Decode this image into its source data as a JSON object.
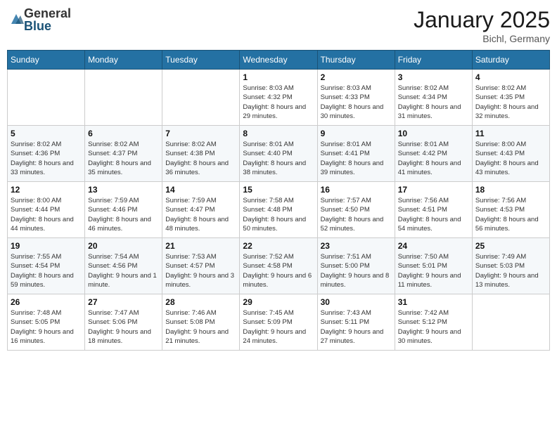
{
  "logo": {
    "general": "General",
    "blue": "Blue"
  },
  "header": {
    "month": "January 2025",
    "location": "Bichl, Germany"
  },
  "days_of_week": [
    "Sunday",
    "Monday",
    "Tuesday",
    "Wednesday",
    "Thursday",
    "Friday",
    "Saturday"
  ],
  "weeks": [
    [
      {
        "day": "",
        "info": ""
      },
      {
        "day": "",
        "info": ""
      },
      {
        "day": "",
        "info": ""
      },
      {
        "day": "1",
        "info": "Sunrise: 8:03 AM\nSunset: 4:32 PM\nDaylight: 8 hours and 29 minutes."
      },
      {
        "day": "2",
        "info": "Sunrise: 8:03 AM\nSunset: 4:33 PM\nDaylight: 8 hours and 30 minutes."
      },
      {
        "day": "3",
        "info": "Sunrise: 8:02 AM\nSunset: 4:34 PM\nDaylight: 8 hours and 31 minutes."
      },
      {
        "day": "4",
        "info": "Sunrise: 8:02 AM\nSunset: 4:35 PM\nDaylight: 8 hours and 32 minutes."
      }
    ],
    [
      {
        "day": "5",
        "info": "Sunrise: 8:02 AM\nSunset: 4:36 PM\nDaylight: 8 hours and 33 minutes."
      },
      {
        "day": "6",
        "info": "Sunrise: 8:02 AM\nSunset: 4:37 PM\nDaylight: 8 hours and 35 minutes."
      },
      {
        "day": "7",
        "info": "Sunrise: 8:02 AM\nSunset: 4:38 PM\nDaylight: 8 hours and 36 minutes."
      },
      {
        "day": "8",
        "info": "Sunrise: 8:01 AM\nSunset: 4:40 PM\nDaylight: 8 hours and 38 minutes."
      },
      {
        "day": "9",
        "info": "Sunrise: 8:01 AM\nSunset: 4:41 PM\nDaylight: 8 hours and 39 minutes."
      },
      {
        "day": "10",
        "info": "Sunrise: 8:01 AM\nSunset: 4:42 PM\nDaylight: 8 hours and 41 minutes."
      },
      {
        "day": "11",
        "info": "Sunrise: 8:00 AM\nSunset: 4:43 PM\nDaylight: 8 hours and 43 minutes."
      }
    ],
    [
      {
        "day": "12",
        "info": "Sunrise: 8:00 AM\nSunset: 4:44 PM\nDaylight: 8 hours and 44 minutes."
      },
      {
        "day": "13",
        "info": "Sunrise: 7:59 AM\nSunset: 4:46 PM\nDaylight: 8 hours and 46 minutes."
      },
      {
        "day": "14",
        "info": "Sunrise: 7:59 AM\nSunset: 4:47 PM\nDaylight: 8 hours and 48 minutes."
      },
      {
        "day": "15",
        "info": "Sunrise: 7:58 AM\nSunset: 4:48 PM\nDaylight: 8 hours and 50 minutes."
      },
      {
        "day": "16",
        "info": "Sunrise: 7:57 AM\nSunset: 4:50 PM\nDaylight: 8 hours and 52 minutes."
      },
      {
        "day": "17",
        "info": "Sunrise: 7:56 AM\nSunset: 4:51 PM\nDaylight: 8 hours and 54 minutes."
      },
      {
        "day": "18",
        "info": "Sunrise: 7:56 AM\nSunset: 4:53 PM\nDaylight: 8 hours and 56 minutes."
      }
    ],
    [
      {
        "day": "19",
        "info": "Sunrise: 7:55 AM\nSunset: 4:54 PM\nDaylight: 8 hours and 59 minutes."
      },
      {
        "day": "20",
        "info": "Sunrise: 7:54 AM\nSunset: 4:56 PM\nDaylight: 9 hours and 1 minute."
      },
      {
        "day": "21",
        "info": "Sunrise: 7:53 AM\nSunset: 4:57 PM\nDaylight: 9 hours and 3 minutes."
      },
      {
        "day": "22",
        "info": "Sunrise: 7:52 AM\nSunset: 4:58 PM\nDaylight: 9 hours and 6 minutes."
      },
      {
        "day": "23",
        "info": "Sunrise: 7:51 AM\nSunset: 5:00 PM\nDaylight: 9 hours and 8 minutes."
      },
      {
        "day": "24",
        "info": "Sunrise: 7:50 AM\nSunset: 5:01 PM\nDaylight: 9 hours and 11 minutes."
      },
      {
        "day": "25",
        "info": "Sunrise: 7:49 AM\nSunset: 5:03 PM\nDaylight: 9 hours and 13 minutes."
      }
    ],
    [
      {
        "day": "26",
        "info": "Sunrise: 7:48 AM\nSunset: 5:05 PM\nDaylight: 9 hours and 16 minutes."
      },
      {
        "day": "27",
        "info": "Sunrise: 7:47 AM\nSunset: 5:06 PM\nDaylight: 9 hours and 18 minutes."
      },
      {
        "day": "28",
        "info": "Sunrise: 7:46 AM\nSunset: 5:08 PM\nDaylight: 9 hours and 21 minutes."
      },
      {
        "day": "29",
        "info": "Sunrise: 7:45 AM\nSunset: 5:09 PM\nDaylight: 9 hours and 24 minutes."
      },
      {
        "day": "30",
        "info": "Sunrise: 7:43 AM\nSunset: 5:11 PM\nDaylight: 9 hours and 27 minutes."
      },
      {
        "day": "31",
        "info": "Sunrise: 7:42 AM\nSunset: 5:12 PM\nDaylight: 9 hours and 30 minutes."
      },
      {
        "day": "",
        "info": ""
      }
    ]
  ]
}
